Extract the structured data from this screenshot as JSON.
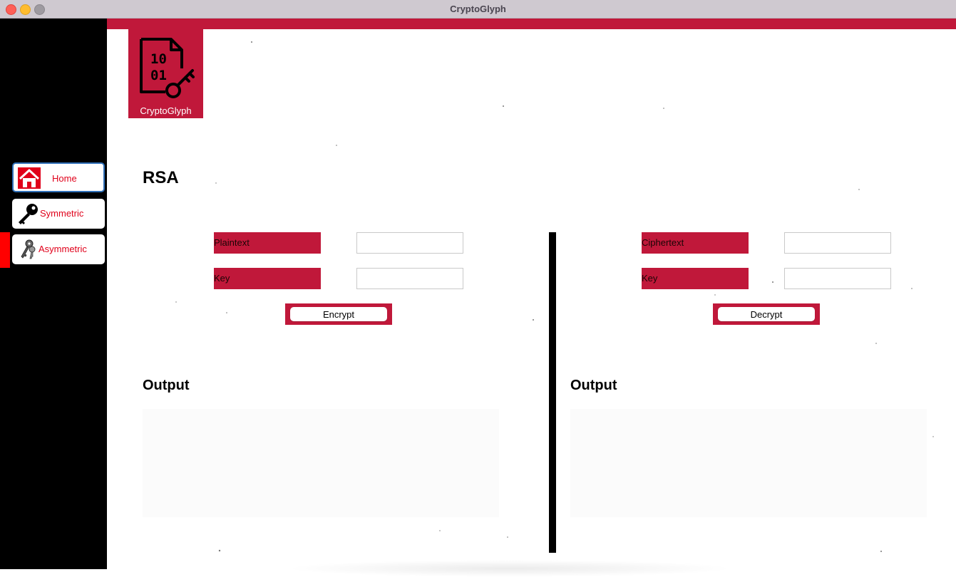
{
  "window": {
    "title": "CryptoGlyph"
  },
  "sidebar": {
    "items": [
      {
        "label": "Home",
        "icon": "home-icon",
        "selected": true
      },
      {
        "label": "Symmetric",
        "icon": "key-icon",
        "selected": false
      },
      {
        "label": "Asymmetric",
        "icon": "keys-icon",
        "selected": false
      }
    ],
    "active_index": 2
  },
  "logo": {
    "glyph_line1": "10",
    "glyph_line2": "01",
    "caption": "CryptoGlyph",
    "icon": "file-key-icon"
  },
  "page": {
    "title": "RSA"
  },
  "encrypt_panel": {
    "plaintext_label": "Plaintext",
    "plaintext_value": "",
    "key_label": "Key",
    "key_value": "",
    "button_label": "Encrypt",
    "output_heading": "Output",
    "output_value": ""
  },
  "decrypt_panel": {
    "ciphertext_label": "Ciphertext",
    "ciphertext_value": "",
    "key_label": "Key",
    "key_value": "",
    "button_label": "Decrypt",
    "output_heading": "Output",
    "output_value": ""
  },
  "colors": {
    "accent": "#c0183a",
    "sidebar_bg": "#000000",
    "nav_text": "#e0001a",
    "active_indicator": "#ff0000"
  }
}
